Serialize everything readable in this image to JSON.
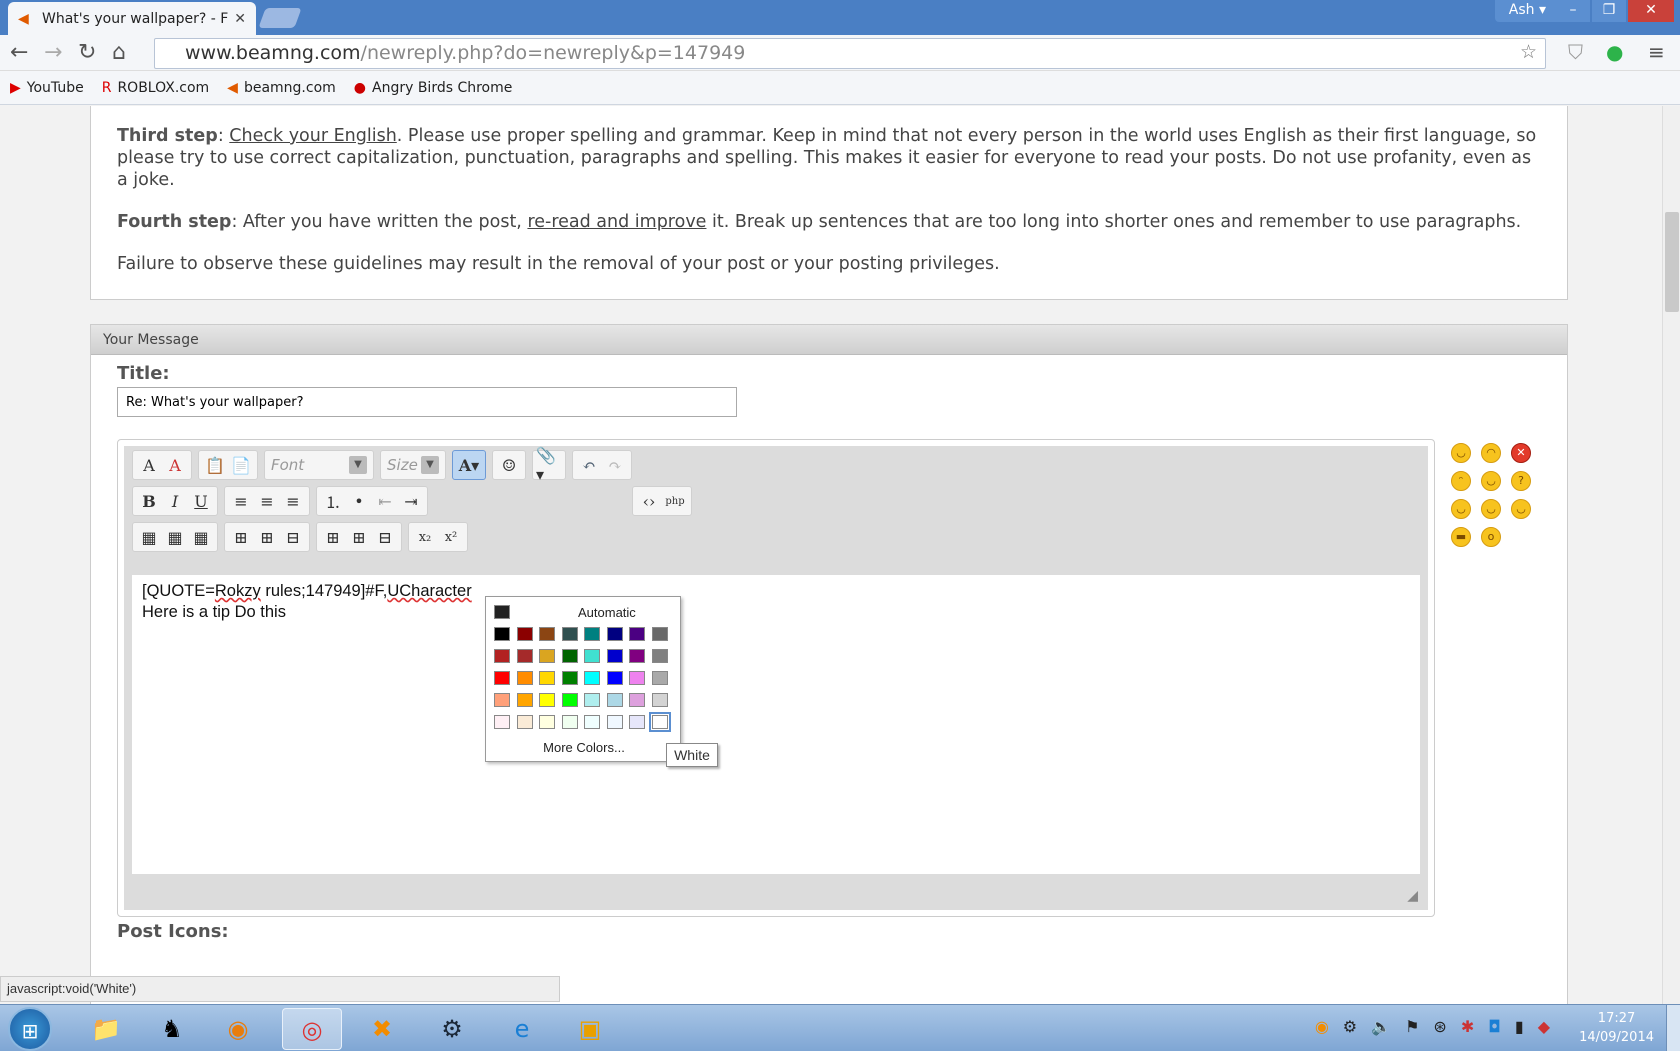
{
  "browser": {
    "tab_title": "What's your wallpaper? - F",
    "user": "Ash",
    "url_host": "www.beamng.com",
    "url_path": "/newreply.php?do=newreply&p=147949",
    "bookmarks": [
      "YouTube",
      "ROBLOX.com",
      "beamng.com",
      "Angry Birds Chrome"
    ]
  },
  "guidelines": {
    "third_label": "Third step",
    "third_link": "Check your English",
    "third_text": ". Please use proper spelling and grammar. Keep in mind that not every person in the world uses English as their first language, so please try to use correct capitalization, punctuation, paragraphs and spelling. This makes it easier for everyone to read your posts. Do not use profanity, even as a joke.",
    "fourth_label": "Fourth step",
    "fourth_pre": ": After you have written the post, ",
    "fourth_link": "re-read and improve",
    "fourth_post": " it. Break up sentences that are too long into shorter ones and remember to use paragraphs.",
    "failure": "Failure to observe these guidelines may result in the removal of your post or your posting privileges."
  },
  "message": {
    "header": "Your Message",
    "title_label": "Title:",
    "title_value": "Re: What's your wallpaper?",
    "font_placeholder": "Font",
    "size_placeholder": "Size",
    "text_pre": "[QUOTE=",
    "text_user": "Rokzy",
    "text_mid": " rules;147949]#F,",
    "text_tail": "UCharacter",
    "text_line2": "Here is a tip Do this",
    "post_icons_label": "Post Icons:"
  },
  "color_picker": {
    "automatic_label": "Automatic",
    "more_colors_label": "More Colors...",
    "tooltip": "White",
    "colors": [
      "#000000",
      "#8b0000",
      "#8b4513",
      "#2f4f4f",
      "#008080",
      "#000080",
      "#4b0082",
      "#696969",
      "#b22222",
      "#a52a2a",
      "#daa520",
      "#006400",
      "#40e0d0",
      "#0000cd",
      "#800080",
      "#808080",
      "#ff0000",
      "#ff8c00",
      "#ffd700",
      "#008000",
      "#00ffff",
      "#0000ff",
      "#ee82ee",
      "#a9a9a9",
      "#ffa07a",
      "#ffa500",
      "#ffff00",
      "#00ff00",
      "#afeeee",
      "#add8e6",
      "#dda0dd",
      "#d3d3d3",
      "#fff0f5",
      "#faebd7",
      "#ffffe0",
      "#f0fff0",
      "#f0ffff",
      "#f0f8ff",
      "#e6e6fa",
      "#ffffff"
    ]
  },
  "status_bar": "javascript:void('White')",
  "clock": {
    "time": "17:27",
    "date": "14/09/2014"
  }
}
